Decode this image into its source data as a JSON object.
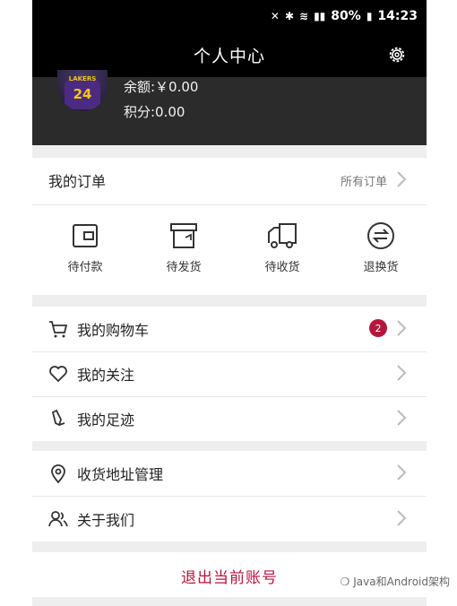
{
  "status_bar": {
    "battery": "80%",
    "time": "14:23"
  },
  "header": {
    "title": "个人中心"
  },
  "profile": {
    "balance": "余额:￥0.00",
    "points": "积分:0.00",
    "avatar_number": "24",
    "avatar_team": "LAKERS"
  },
  "orders": {
    "title": "我的订单",
    "all_label": "所有订单",
    "items": [
      {
        "label": "待付款",
        "icon": "wallet-icon"
      },
      {
        "label": "待发货",
        "icon": "box-icon"
      },
      {
        "label": "待收货",
        "icon": "truck-icon"
      },
      {
        "label": "退换货",
        "icon": "exchange-icon"
      }
    ]
  },
  "menu1": [
    {
      "label": "我的购物车",
      "icon": "cart-icon",
      "badge": "2"
    },
    {
      "label": "我的关注",
      "icon": "heart-icon"
    },
    {
      "label": "我的足迹",
      "icon": "footprint-icon"
    }
  ],
  "menu2": [
    {
      "label": "收货地址管理",
      "icon": "location-icon"
    },
    {
      "label": "关于我们",
      "icon": "users-icon"
    }
  ],
  "logout_label": "退出当前账号",
  "watermark": "Java和Android架构",
  "colors": {
    "accent": "#b3163c",
    "header_bg": "#000000",
    "profile_bg": "#2b2b2b"
  }
}
